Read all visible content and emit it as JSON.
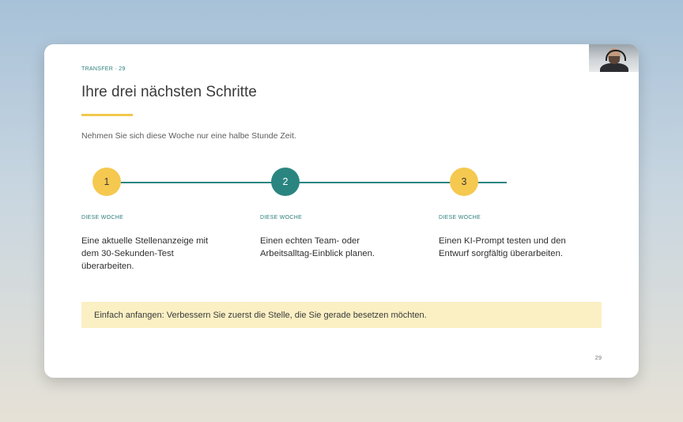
{
  "slide": {
    "kicker": "TRANSFER · 29",
    "title": "Ihre drei nächsten Schritte",
    "subtitle": "Nehmen Sie sich diese Woche nur eine halbe Stunde Zeit.",
    "steps": [
      {
        "number": "1",
        "tag": "DIESE WOCHE",
        "text": "Eine aktuelle Stellenanzeige mit dem 30-Sekunden-Test überarbeiten.",
        "color": "#f5c84f"
      },
      {
        "number": "2",
        "tag": "DIESE WOCHE",
        "text": "Einen echten Team- oder Arbeitsalltag-Einblick planen.",
        "color": "#2a8581"
      },
      {
        "number": "3",
        "tag": "DIESE WOCHE",
        "text": "Einen KI-Prompt testen und den Entwurf sorgfältig überarbeiten.",
        "color": "#f5c84f"
      }
    ],
    "callout": "Einfach anfangen: Verbessern Sie zuerst die Stelle, die Sie gerade besetzen möchten.",
    "page_number": "29"
  },
  "colors": {
    "accent_yellow": "#f5c84f",
    "accent_teal": "#2a8581",
    "callout_bg": "#fbf0c4"
  },
  "webcam": {
    "icon": "webcam-person"
  }
}
